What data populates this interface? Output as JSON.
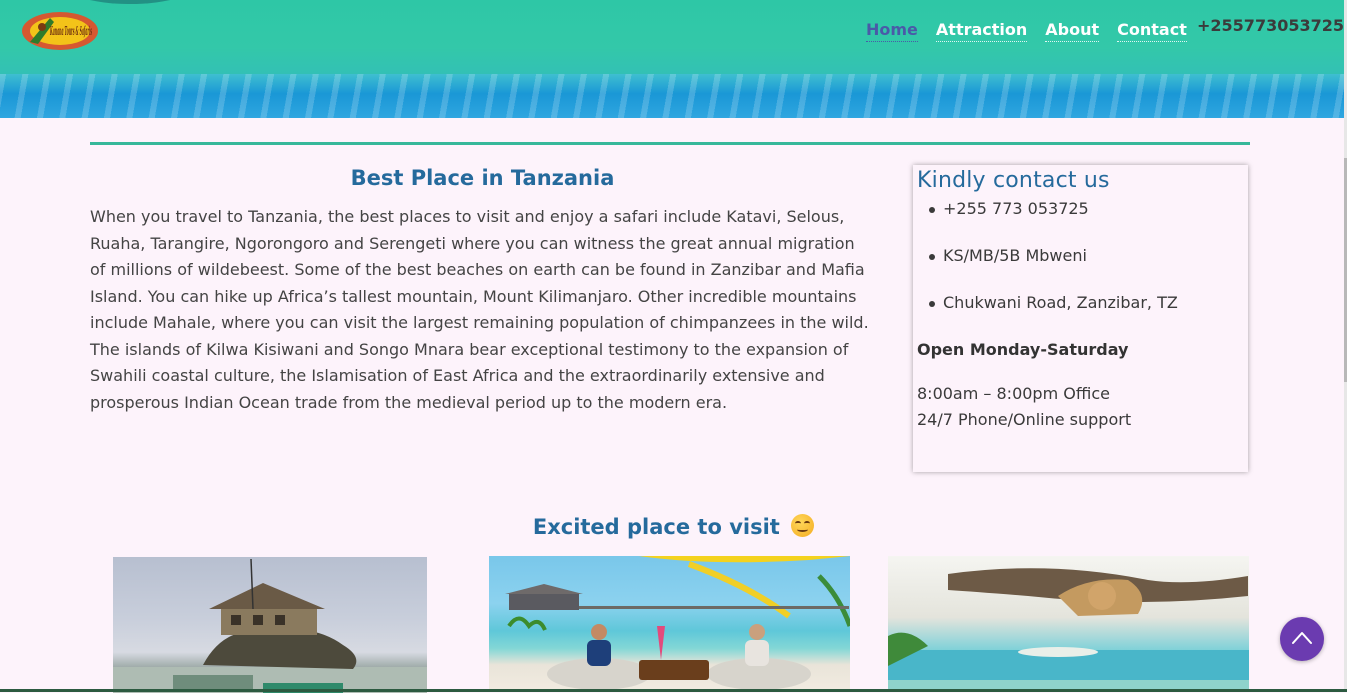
{
  "header": {
    "logo_text": "Kanana Tours & Safaris",
    "nav": [
      {
        "label": "Home",
        "active": true
      },
      {
        "label": "Attraction",
        "active": false
      },
      {
        "label": "About",
        "active": false
      },
      {
        "label": "Contact",
        "active": false
      }
    ],
    "phone": "+255773053725"
  },
  "intro": {
    "title": "Best Place in Tanzania",
    "body": "When you travel to Tanzania, the best places to visit and enjoy a safari include Katavi, Selous, Ruaha, Tarangire, Ngorongoro and Serengeti where you can witness the great annual migration of millions of wildebeest. Some of the best beaches on earth can be found in Zanzibar and Mafia Island. You can hike up Africa’s tallest mountain, Mount Kilimanjaro. Other incredible mountains include Mahale, where you can visit the largest remaining population of chimpanzees in the wild. The islands of Kilwa Kisiwani and Songo Mnara bear exceptional testimony to the expansion of Swahili coastal culture, the Islamisation of East Africa and the extraordinarily extensive and prosperous Indian Ocean trade from the medieval period up to the modern era."
  },
  "contact": {
    "title": "Kindly contact us",
    "items": [
      "+255 773 053725",
      "KS/MB/5B Mbweni",
      "Chukwani Road, Zanzibar, TZ"
    ],
    "hours_title": "Open Monday-Saturday",
    "office_hours": "8:00am – 8:00pm Office",
    "support": "24/7 Phone/Online support"
  },
  "places": {
    "title": "Excited place to visit",
    "emoji": "smiling-face-icon",
    "photos": [
      "rock-restaurant-photo",
      "beach-lounge-photo",
      "lioness-beach-photo"
    ]
  },
  "colors": {
    "heading": "#256a9c",
    "accent": "#36b89a",
    "back_to_top": "#6b3bb0",
    "active_nav": "#4a5aa8"
  }
}
